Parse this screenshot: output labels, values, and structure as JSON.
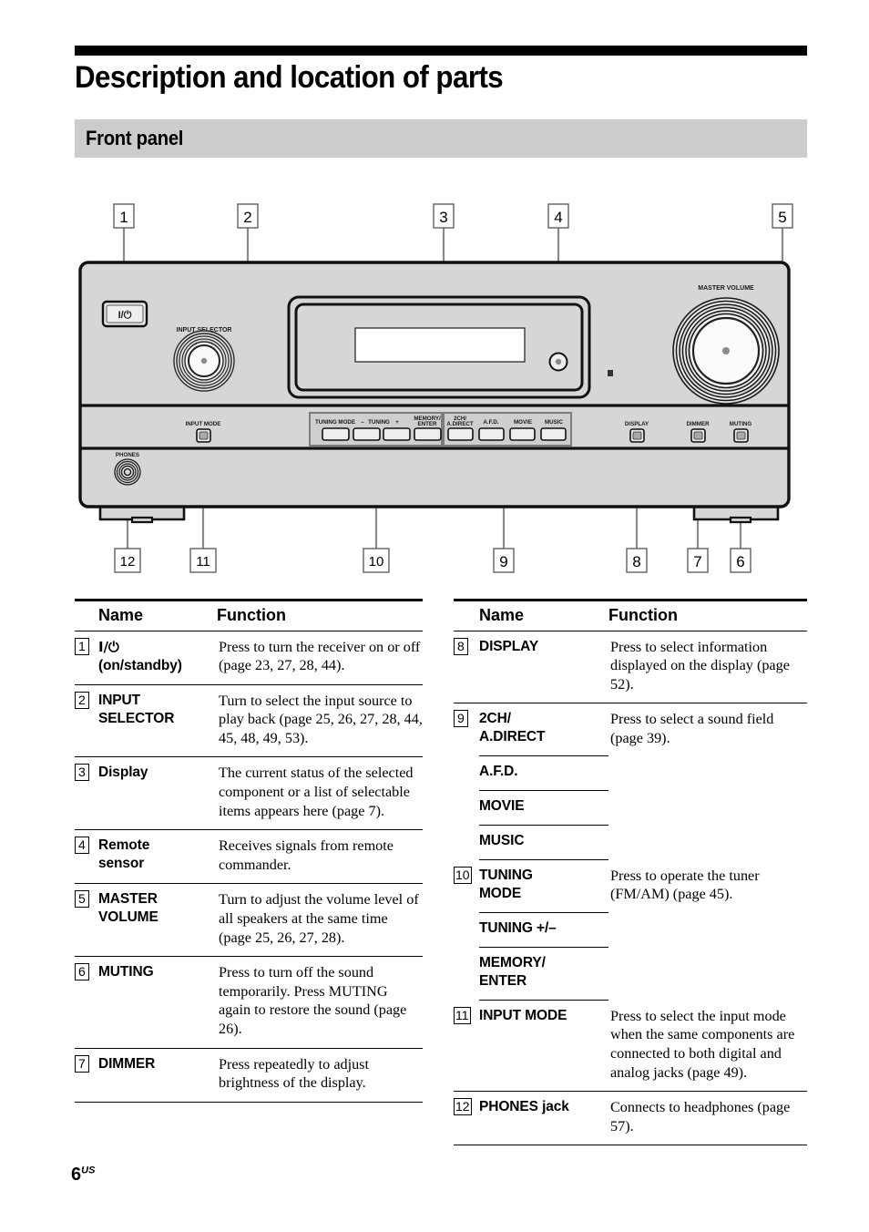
{
  "page": {
    "title": "Description and location of parts",
    "section_heading": "Front panel",
    "number": "6",
    "number_suffix": "US"
  },
  "diagram": {
    "device_labels": {
      "power": "I/⏻",
      "input_selector": "INPUT SELECTOR",
      "master_volume": "MASTER VOLUME",
      "phones": "PHONES",
      "input_mode": "INPUT MODE",
      "tuning_mode": "TUNING MODE",
      "tuning_minus": "–",
      "tuning": "TUNING",
      "tuning_plus": "+",
      "memory_enter_line1": "MEMORY/",
      "memory_enter_line2": "ENTER",
      "two_ch_line1": "2CH/",
      "two_ch_line2": "A.DIRECT",
      "afd": "A.F.D.",
      "movie": "MOVIE",
      "music": "MUSIC",
      "display": "DISPLAY",
      "dimmer": "DIMMER",
      "muting": "MUTING"
    },
    "callouts_top": [
      "1",
      "2",
      "3",
      "4",
      "5"
    ],
    "callouts_bottom": [
      "12",
      "11",
      "10",
      "9",
      "8",
      "7",
      "6"
    ]
  },
  "tables": {
    "headers": {
      "name": "Name",
      "function": "Function"
    },
    "left_rows": [
      {
        "num": "1",
        "name_lines": [
          "I/⏻",
          "(on/standby)"
        ],
        "function": "Press to turn the receiver on or off (page 23, 27, 28, 44)."
      },
      {
        "num": "2",
        "name_lines": [
          "INPUT",
          "SELECTOR"
        ],
        "function": "Turn to select the input source to play back (page 25, 26, 27, 28, 44, 45, 48, 49, 53)."
      },
      {
        "num": "3",
        "name_lines": [
          "Display"
        ],
        "function": "The current status of the selected component or a list of selectable items appears here (page 7)."
      },
      {
        "num": "4",
        "name_lines": [
          "Remote",
          "sensor"
        ],
        "function": "Receives signals from remote commander."
      },
      {
        "num": "5",
        "name_lines": [
          "MASTER",
          "VOLUME"
        ],
        "function": "Turn to adjust the volume level of all speakers at the same time (page 25, 26, 27, 28)."
      },
      {
        "num": "6",
        "name_lines": [
          "MUTING"
        ],
        "function": "Press to turn off the sound temporarily. Press MUTING again to restore the sound (page 26)."
      },
      {
        "num": "7",
        "name_lines": [
          "DIMMER"
        ],
        "function": "Press repeatedly to adjust brightness of the display."
      }
    ],
    "right_rows": [
      {
        "num": "8",
        "sub_names": [
          [
            "DISPLAY"
          ]
        ],
        "function": "Press to select information displayed on the display (page 52)."
      },
      {
        "num": "9",
        "sub_names": [
          [
            "2CH/",
            "A.DIRECT"
          ],
          [
            "A.F.D."
          ],
          [
            "MOVIE"
          ],
          [
            "MUSIC"
          ]
        ],
        "function": "Press to select a sound field (page 39)."
      },
      {
        "num": "10",
        "sub_names": [
          [
            "TUNING",
            "MODE"
          ],
          [
            "TUNING +/–"
          ],
          [
            "MEMORY/",
            "ENTER"
          ]
        ],
        "function": "Press to operate the tuner (FM/AM) (page 45)."
      },
      {
        "num": "11",
        "sub_names": [
          [
            "INPUT MODE"
          ]
        ],
        "function": "Press to select the input mode when the same components are connected to both digital and analog jacks (page 49)."
      },
      {
        "num": "12",
        "sub_names": [
          [
            "PHONES jack"
          ]
        ],
        "function": "Connects to headphones (page 57)."
      }
    ]
  }
}
